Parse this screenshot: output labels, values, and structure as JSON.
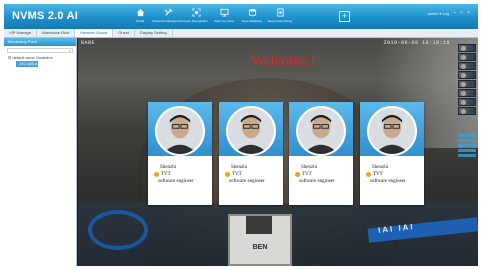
{
  "app": {
    "title": "NVMS 2.0 AI"
  },
  "nav": [
    {
      "label": "Portal",
      "icon": "home-icon"
    },
    {
      "label": "Resource Management",
      "icon": "tools-icon"
    },
    {
      "label": "Face Recognition",
      "icon": "face-scan-icon"
    },
    {
      "label": "Web Live View",
      "icon": "monitor-icon"
    },
    {
      "label": "Face Database",
      "icon": "database-icon"
    },
    {
      "label": "Record Recording",
      "icon": "record-icon"
    }
  ],
  "nav_extra": {
    "label": "+"
  },
  "top_right": {
    "user": "admin ▾ Log",
    "minimize": "–",
    "maximize": "□",
    "close": "×"
  },
  "tabs": [
    {
      "label": "VIP Manage",
      "active": false
    },
    {
      "label": "Attendace Rule",
      "active": false
    },
    {
      "label": "Member Guard",
      "active": true
    },
    {
      "label": "Guest",
      "active": false
    },
    {
      "label": "Display Setting",
      "active": false
    }
  ],
  "left_panel": {
    "header": "Monitoring Point",
    "tree": [
      {
        "label": "⊟ default area/ Guideline",
        "selected": false
      },
      {
        "label": "192.168.8",
        "selected": true
      }
    ]
  },
  "video": {
    "osd_left": "BABE",
    "osd_right": "2019-09-09 19:19:19",
    "welcome": "Welcome",
    "welcome_mark": "!",
    "badge_text": "BEN",
    "strap_text": "IAI IAI"
  },
  "cards": [
    {
      "name": "Shenzhi",
      "org": "TVT",
      "job": "software engineer"
    },
    {
      "name": "Shenzhi",
      "org": "TVT",
      "job": "software engineer"
    },
    {
      "name": "Shenzhi",
      "org": "TVT",
      "job": "software engineer"
    },
    {
      "name": "Shenzhi",
      "org": "TVT",
      "job": "software engineer"
    }
  ],
  "colors": {
    "accent": "#1d8fc9",
    "welcome": "#d8262a",
    "card_header": "#2f8fd0"
  }
}
